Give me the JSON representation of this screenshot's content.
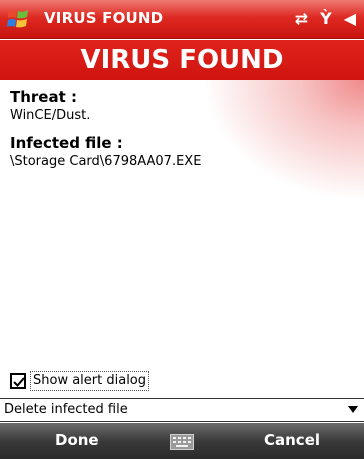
{
  "titlebar": {
    "title": "VIRUS FOUND",
    "icons": [
      "windows-start-icon",
      "connectivity-icon",
      "signal-off-icon",
      "volume-icon"
    ]
  },
  "banner": {
    "text": "VIRUS FOUND"
  },
  "details": {
    "threat_label": "Threat :",
    "threat_value": "WinCE/Dust.",
    "file_label": "Infected file :",
    "file_value": "\\Storage Card\\6798AA07.EXE"
  },
  "alert_option": {
    "label": "Show alert dialog",
    "checked": true
  },
  "action_select": {
    "selected": "Delete infected file"
  },
  "softkeys": {
    "left": "Done",
    "right": "Cancel",
    "middle_icon": "keyboard-icon"
  },
  "colors": {
    "accent_red": "#dd2a22",
    "softbar": "#3a3a3a"
  }
}
